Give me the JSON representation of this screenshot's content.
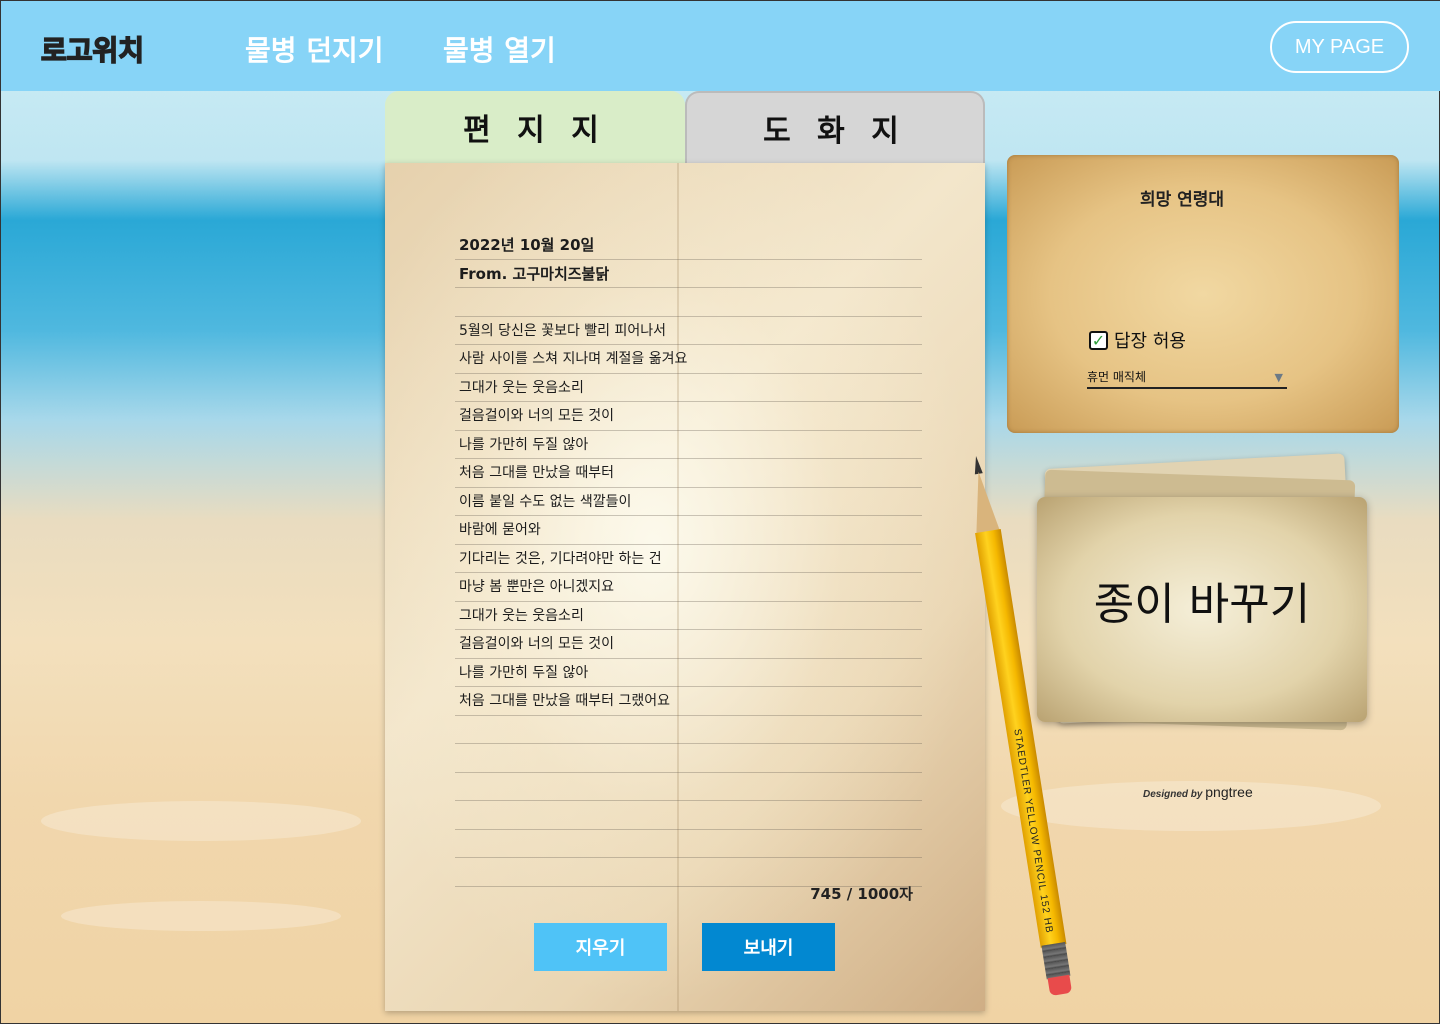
{
  "header": {
    "logo": "로고위치",
    "nav": [
      "물병 던지기",
      "물병 열기"
    ],
    "my_page": "MY PAGE"
  },
  "tabs": [
    {
      "label": "편 지 지",
      "active": true
    },
    {
      "label": "도 화 지",
      "active": false
    }
  ],
  "letter": {
    "date": "2022년 10월 20일",
    "from": "From. 고구마치즈불닭",
    "body_lines": [
      "",
      "5월의 당신은 꽃보다 빨리 피어나서",
      "사람 사이를 스쳐 지나며 계절을 옮겨요",
      "그대가 웃는 웃음소리",
      "걸음걸이와 너의 모든 것이",
      "나를 가만히 두질 않아",
      "처음 그대를 만났을 때부터",
      "이름 붙일 수도 없는 색깔들이",
      "바람에 묻어와",
      "기다리는 것은, 기다려야만 하는 건",
      "마냥 봄 뿐만은 아니겠지요",
      "그대가 웃는 웃음소리",
      "걸음걸이와 너의 모든 것이",
      "나를 가만히 두질 않아",
      "처음 그대를 만났을 때부터 그랬어요",
      "",
      "",
      "",
      "",
      "",
      ""
    ],
    "char_count": "745 / 1000자",
    "erase_label": "지우기",
    "send_label": "보내기"
  },
  "pencil": {
    "label": "STAEDTLER YELLOW PENCIL 152 HB"
  },
  "settings": {
    "title": "희망 연령대",
    "reply_label": "답장 허용",
    "reply_checked": true,
    "font_selected": "휴먼 매직체"
  },
  "change_paper": {
    "label": "종이 바꾸기"
  },
  "credit": {
    "prefix": "Designed by",
    "brand": "pngtree"
  },
  "colors": {
    "topbar": "#87d4f7",
    "tab_active": "#d9edc8",
    "tab_inactive": "#d6d6d6",
    "erase_button": "#4fc3f7",
    "send_button": "#0288d1"
  }
}
